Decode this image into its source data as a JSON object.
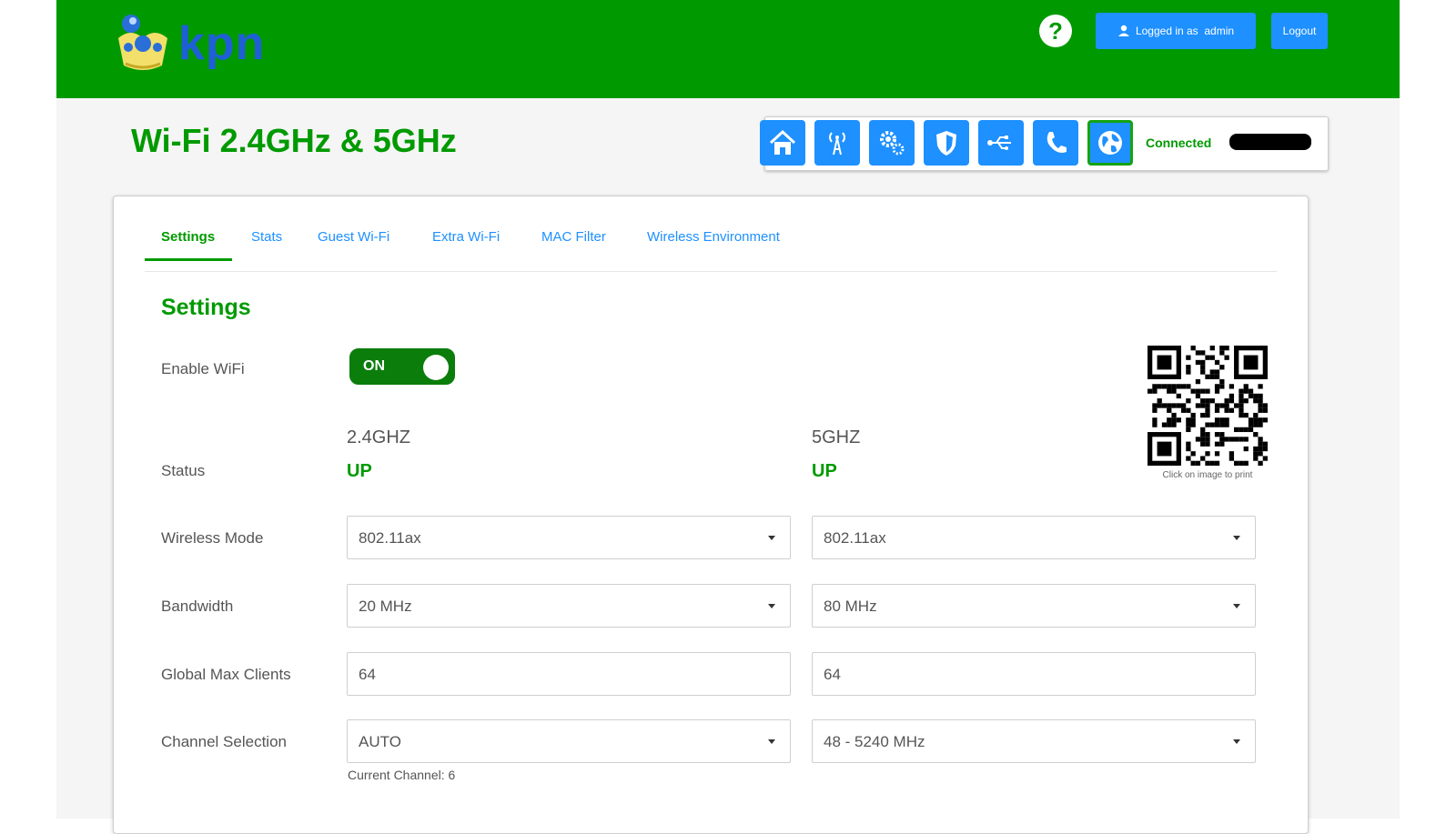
{
  "header": {
    "brand": "kpn",
    "help_icon": "?",
    "logged_in_label": "Logged in as",
    "user": "admin",
    "logout_label": "Logout",
    "brand_color": "#009a00",
    "accent_color": "#1e90ff"
  },
  "page": {
    "title": "Wi-Fi 2.4GHz & 5GHz"
  },
  "nav": {
    "icons": [
      "home-icon",
      "wireless-icon",
      "settings-gears-icon",
      "shield-icon",
      "usb-icon",
      "phone-icon",
      "globe-icon"
    ],
    "active": "globe-icon",
    "connection_label": "Connected"
  },
  "tabs": [
    "Settings",
    "Stats",
    "Guest Wi-Fi",
    "Extra Wi-Fi",
    "MAC Filter",
    "Wireless Environment"
  ],
  "active_tab": "Settings",
  "settings": {
    "heading": "Settings",
    "enable_label": "Enable WiFi",
    "toggle_state": "ON",
    "band_24": "2.4GHZ",
    "band_5": "5GHZ",
    "status_label": "Status",
    "status_24": "UP",
    "status_5": "UP",
    "mode_label": "Wireless Mode",
    "mode_24": "802.11ax",
    "mode_5": "802.11ax",
    "bw_label": "Bandwidth",
    "bw_24": "20 MHz",
    "bw_5": "80 MHz",
    "clients_label": "Global Max Clients",
    "clients_24": "64",
    "clients_5": "64",
    "channel_label": "Channel Selection",
    "channel_24": "AUTO",
    "channel_5": "48 - 5240 MHz",
    "current_channel": "Current Channel: 6",
    "qr_caption": "Click on image to print"
  }
}
